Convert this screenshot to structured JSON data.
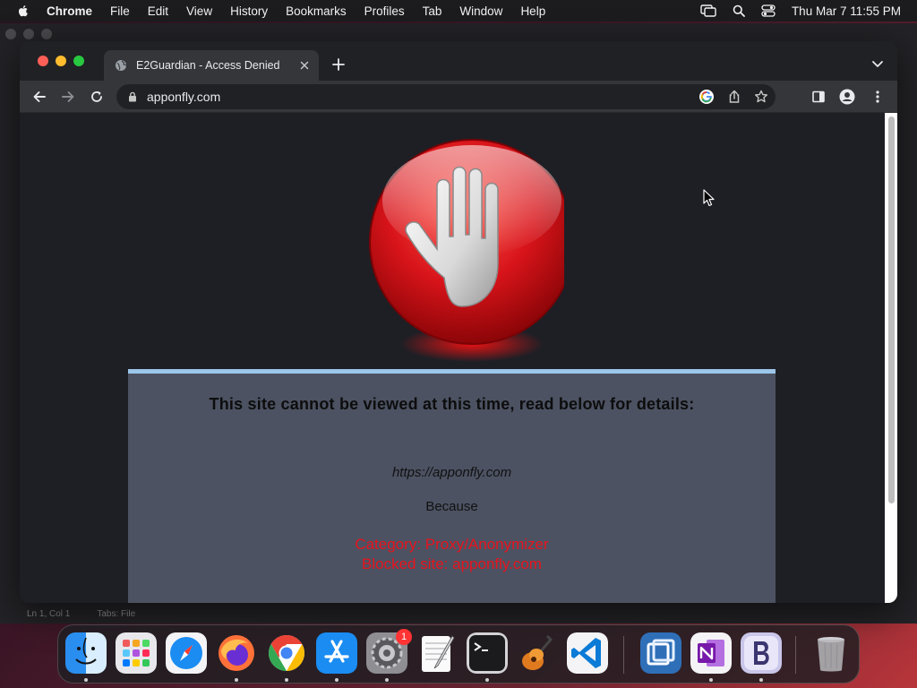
{
  "menubar": {
    "app_name": "Chrome",
    "items": [
      "File",
      "Edit",
      "View",
      "History",
      "Bookmarks",
      "Profiles",
      "Tab",
      "Window",
      "Help"
    ],
    "clock": "Thu Mar 7  11:55 PM"
  },
  "background_window": {
    "status_left": "Ln 1, Col 1",
    "status_right": "Tabs: File"
  },
  "browser": {
    "tab_title": "E2Guardian - Access Denied",
    "url": "apponfly.com"
  },
  "page": {
    "headline": "This site cannot be viewed at this time, read below for details:",
    "blocked_url": "https://apponfly.com",
    "because_label": "Because",
    "category_line": "Category: Proxy/Anonymizer",
    "blocked_site_line": "Blocked site: apponfly.com"
  },
  "dock": {
    "settings_badge": "1",
    "apps": [
      "finder-icon",
      "launchpad-icon",
      "safari-icon",
      "firefox-icon",
      "chrome-icon",
      "app-store-icon",
      "system-settings-icon",
      "textedit-icon",
      "terminal-icon",
      "garageband-icon",
      "vscode-icon",
      "screen-sharing-icon",
      "onenote-icon",
      "bbedit-icon",
      "trash-icon"
    ]
  },
  "colors": {
    "reason_text": "#e8141e",
    "panel_bg": "#4c5262",
    "panel_border": "#9cc6ea",
    "page_bg": "#1e1f25"
  }
}
